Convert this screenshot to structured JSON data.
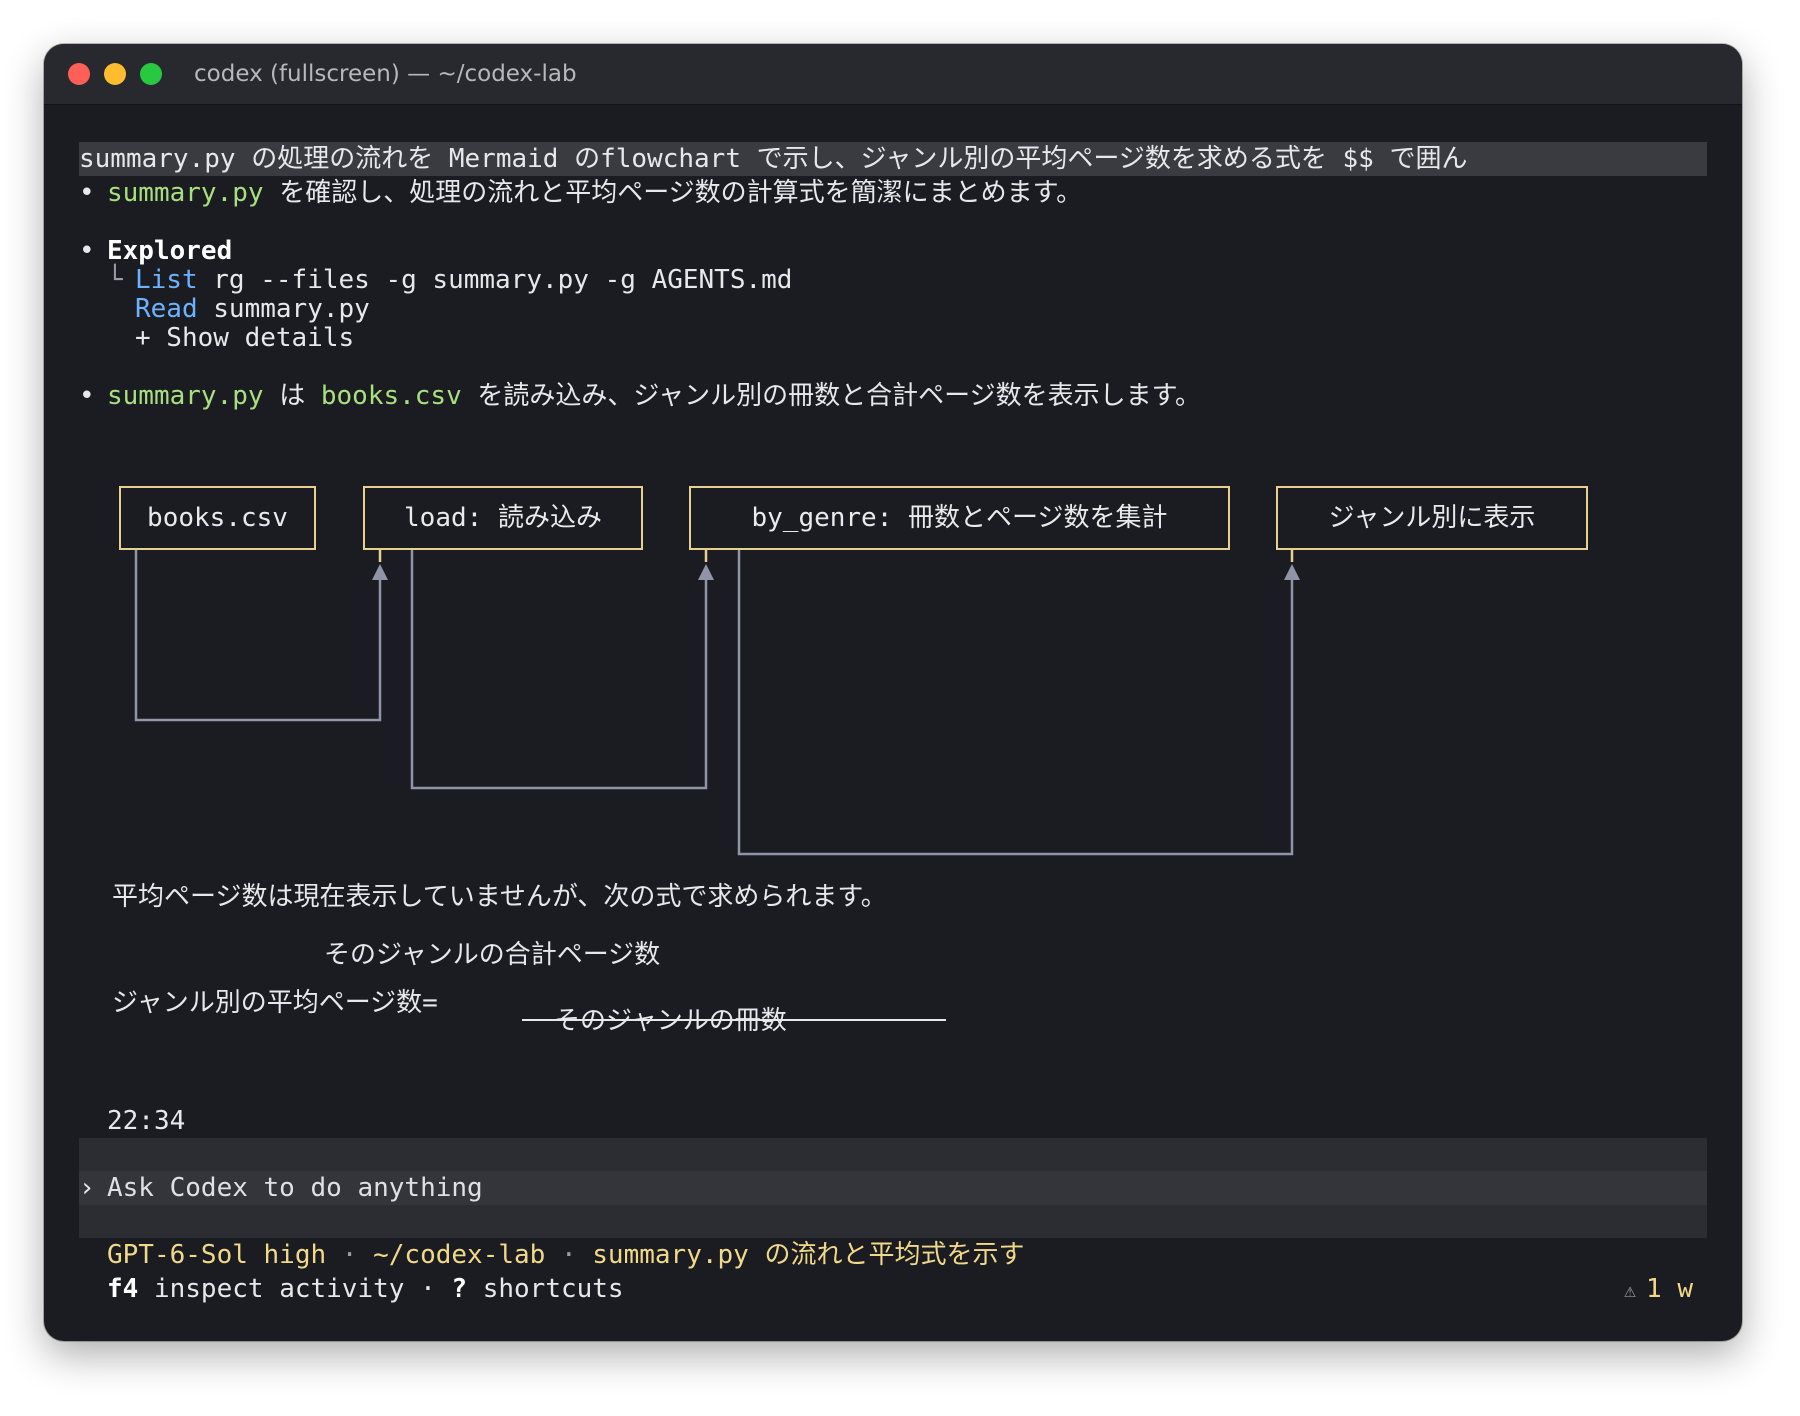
{
  "window": {
    "title": "codex (fullscreen) — ~/codex-lab"
  },
  "prompt_echo": {
    "file": "summary.py",
    "t1": " の処理の流れを ",
    "mermaid": "Mermaid",
    "t2": " の",
    "flowchart": "flowchart",
    "t3": " で示し、ジャンル別の平均ページ数を求める式を ",
    "dollars": "$$",
    "t4": " で囲ん"
  },
  "line1": {
    "bullet": "•",
    "file": "summary.py",
    "rest": " を確認し、処理の流れと平均ページ数の計算式を簡潔にまとめます。"
  },
  "explored": {
    "bullet": "•",
    "title": "Explored",
    "branch": "└",
    "list_label": "List",
    "list_cmd": " rg --files -g summary.py -g AGENTS.md",
    "read_label": "Read",
    "read_file": " summary.py",
    "details": "+ Show details"
  },
  "line2": {
    "bullet": "•",
    "file": "summary.py",
    "t1": " は ",
    "csv": "books.csv",
    "t2": " を読み込み、ジャンル別の冊数と合計ページ数を表示します。"
  },
  "flow": {
    "nodes": [
      "books.csv",
      "load: 読み込み",
      "by_genre: 冊数とページ数を集計",
      "ジャンル別に表示"
    ],
    "edges": [
      [
        0,
        1
      ],
      [
        1,
        2
      ],
      [
        2,
        3
      ]
    ]
  },
  "formula": {
    "intro": "平均ページ数は現在表示していませんが、次の式で求められます。",
    "numerator": "そのジャンルの合計ページ数",
    "lhs": "ジャンル別の平均ページ数=",
    "denominator": "そのジャンルの冊数"
  },
  "timestamp": "22:34",
  "composer": {
    "chevron": "›",
    "placeholder": "Ask Codex to do anything"
  },
  "status": {
    "model": "GPT-6-Sol high",
    "sep": " · ",
    "path": "~/codex-lab",
    "task_file": "summary.py",
    "task_rest": " の流れと平均式を示す",
    "key": "f4",
    "hint1": " inspect activity · ",
    "qmark": "?",
    "hint2": " shortcuts",
    "warn_icon": "⚠",
    "warn_text": "1 w"
  },
  "colors": {
    "background": "#1b1c21",
    "accent_green": "#a8e07f",
    "accent_blue": "#6cb2ff",
    "accent_yellow": "#f1d98a",
    "box_border": "#e8d18f",
    "connector": "#9094a8"
  }
}
